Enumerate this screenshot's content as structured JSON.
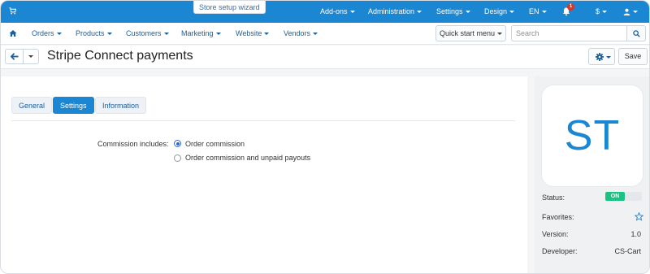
{
  "topbar": {
    "wizard_label": "Store setup wizard",
    "menu": [
      {
        "label": "Add-ons"
      },
      {
        "label": "Administration"
      },
      {
        "label": "Settings"
      },
      {
        "label": "Design"
      },
      {
        "label": "EN"
      },
      {
        "label": "$"
      }
    ],
    "notification_count": "1",
    "icons": [
      "cart-icon",
      "bell-icon",
      "user-icon"
    ]
  },
  "navbar": {
    "items": [
      {
        "label": "Orders"
      },
      {
        "label": "Products"
      },
      {
        "label": "Customers"
      },
      {
        "label": "Marketing"
      },
      {
        "label": "Website"
      },
      {
        "label": "Vendors"
      }
    ],
    "quick_start_label": "Quick start menu",
    "search_placeholder": "Search"
  },
  "titlebar": {
    "title": "Stripe Connect payments",
    "save_label": "Save"
  },
  "tabs": [
    {
      "label": "General",
      "active": false
    },
    {
      "label": "Settings",
      "active": true
    },
    {
      "label": "Information",
      "active": false
    }
  ],
  "settings": {
    "commission_label": "Commission includes:",
    "options": [
      {
        "label": "Order commission",
        "checked": true
      },
      {
        "label": "Order commission and unpaid payouts",
        "checked": false
      }
    ]
  },
  "sidebar": {
    "logo_text": "ST",
    "status_label": "Status:",
    "status_value": "ON",
    "favorites_label": "Favorites:",
    "version_label": "Version:",
    "version_value": "1.0",
    "developer_label": "Developer:",
    "developer_value": "CS-Cart"
  },
  "colors": {
    "accent": "#1b87d3",
    "status_on": "#1ac383",
    "link": "#1b5fa0"
  }
}
